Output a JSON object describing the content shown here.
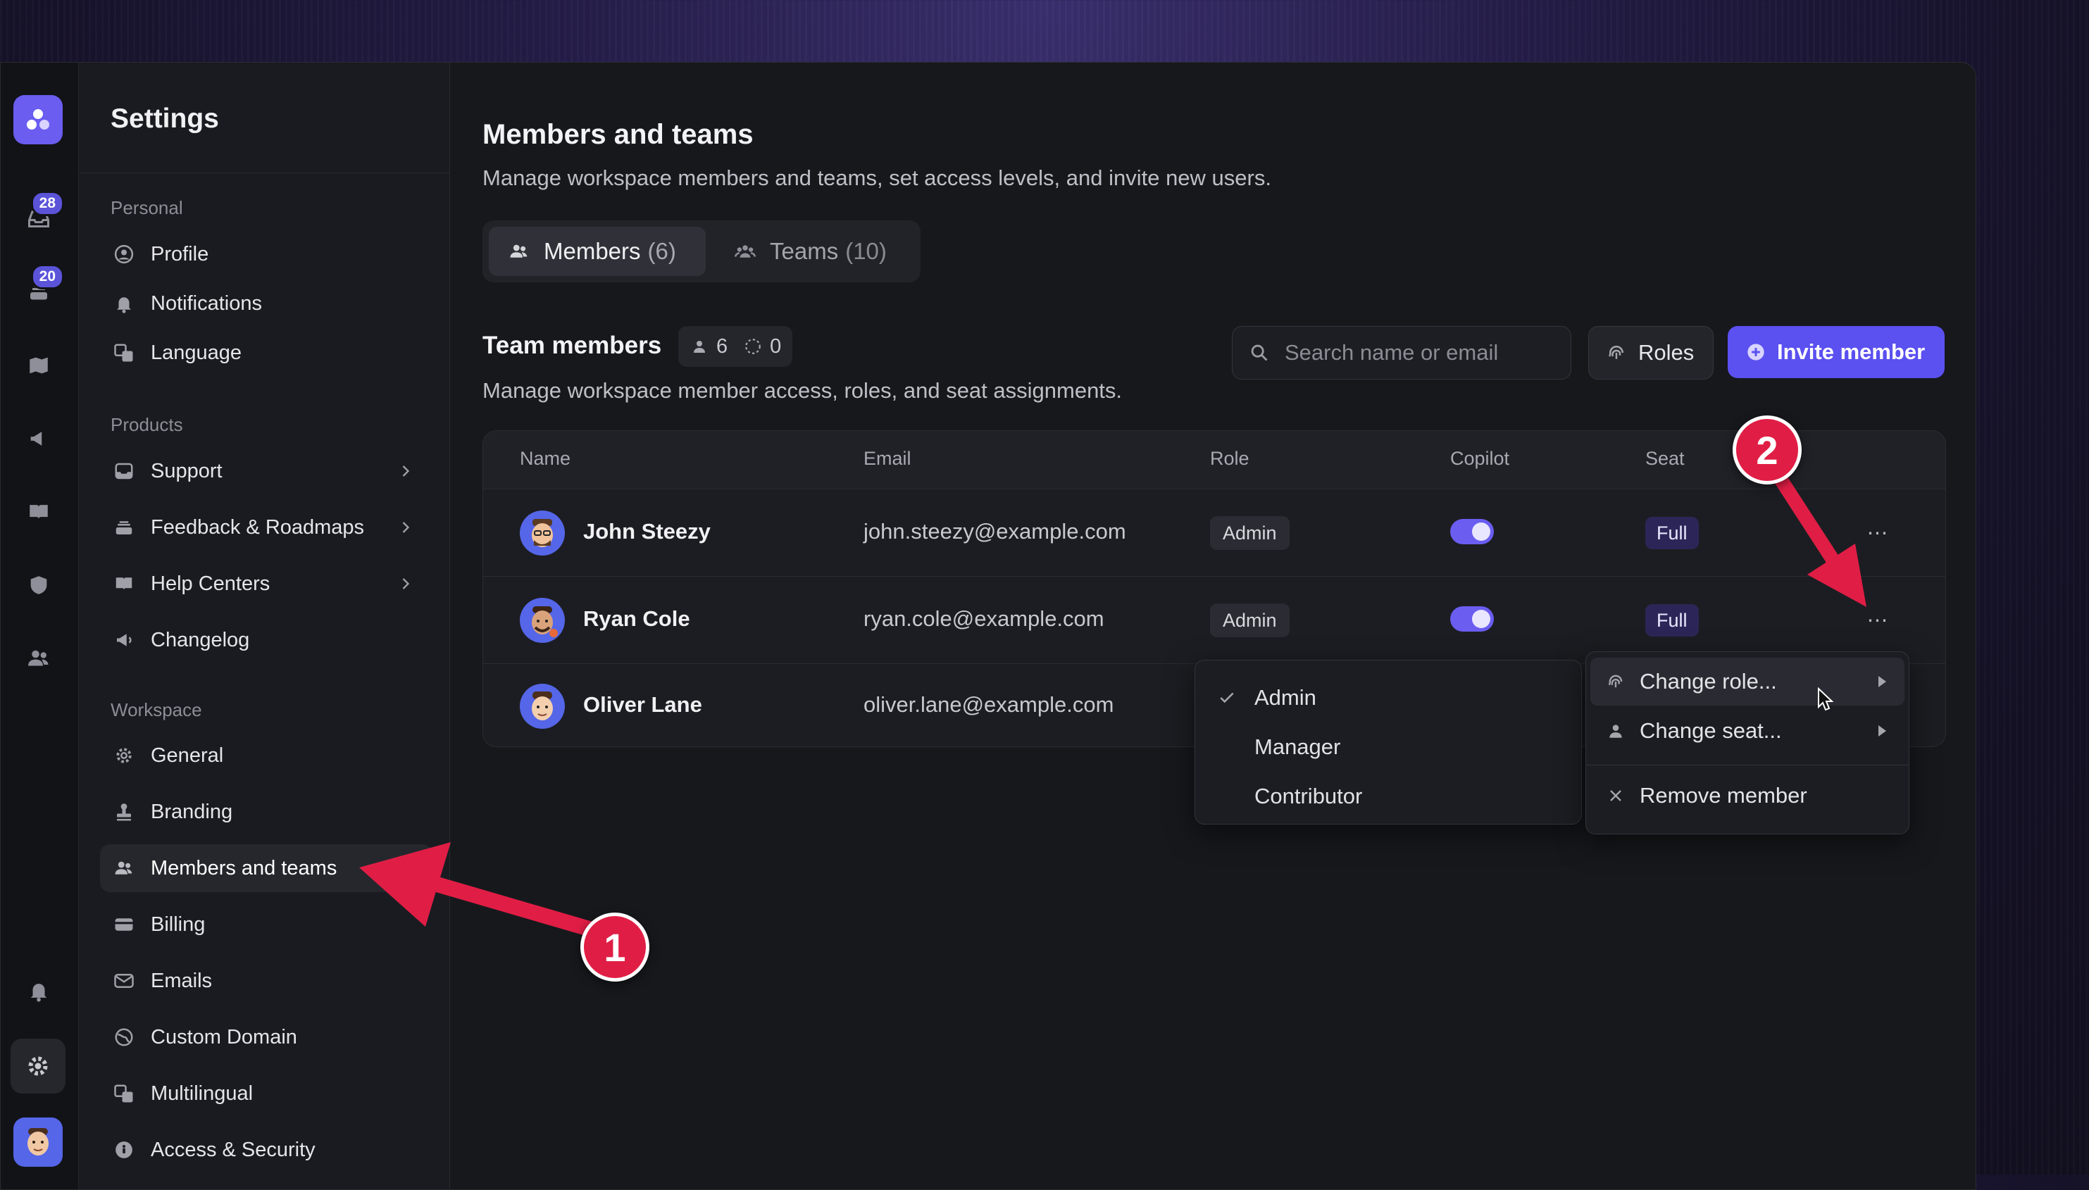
{
  "rail": {
    "badges": [
      "28",
      "20"
    ]
  },
  "sidebar": {
    "title": "Settings",
    "sections": [
      {
        "label": "Personal",
        "items": [
          {
            "label": "Profile",
            "icon": "user-circle-icon"
          },
          {
            "label": "Notifications",
            "icon": "bell-icon"
          },
          {
            "label": "Language",
            "icon": "translate-icon"
          }
        ]
      },
      {
        "label": "Products",
        "items": [
          {
            "label": "Support",
            "icon": "inbox-icon"
          },
          {
            "label": "Feedback & Roadmaps",
            "icon": "stack-icon"
          },
          {
            "label": "Help Centers",
            "icon": "book-icon"
          },
          {
            "label": "Changelog",
            "icon": "megaphone-icon"
          }
        ]
      },
      {
        "label": "Workspace",
        "items": [
          {
            "label": "General",
            "icon": "gear-icon"
          },
          {
            "label": "Branding",
            "icon": "stamp-icon"
          },
          {
            "label": "Members and teams",
            "icon": "users-icon"
          },
          {
            "label": "Billing",
            "icon": "credit-card-icon"
          },
          {
            "label": "Emails",
            "icon": "mail-icon"
          },
          {
            "label": "Custom Domain",
            "icon": "globe-icon"
          },
          {
            "label": "Multilingual",
            "icon": "translate-icon"
          },
          {
            "label": "Access & Security",
            "icon": "shield-icon"
          }
        ]
      }
    ]
  },
  "page": {
    "title": "Members and teams",
    "subtitle": "Manage workspace members and teams, set access levels, and invite new users."
  },
  "tabs": [
    {
      "label": "Members",
      "count": "(6)"
    },
    {
      "label": "Teams",
      "count": "(10)"
    }
  ],
  "members_section": {
    "title": "Team members",
    "active_count": "6",
    "pending_count": "0",
    "subtitle": "Manage workspace member access, roles, and seat assignments.",
    "search_placeholder": "Search name or email",
    "roles_label": "Roles",
    "invite_label": "Invite member"
  },
  "table": {
    "headers": [
      "Name",
      "Email",
      "Role",
      "Copilot",
      "Seat"
    ],
    "rows": [
      {
        "name": "John Steezy",
        "email": "john.steezy@example.com",
        "role": "Admin",
        "copilot": true,
        "seat": "Full"
      },
      {
        "name": "Ryan Cole",
        "email": "ryan.cole@example.com",
        "role": "Admin",
        "copilot": true,
        "seat": "Full"
      },
      {
        "name": "Oliver Lane",
        "email": "oliver.lane@example.com",
        "role": "",
        "copilot": false,
        "seat": ""
      }
    ]
  },
  "role_menu": {
    "options": [
      "Admin",
      "Manager",
      "Contributor"
    ],
    "selected": "Admin"
  },
  "actions_menu": {
    "items": [
      "Change role...",
      "Change seat...",
      "Remove member"
    ]
  },
  "annotations": [
    "1",
    "2"
  ],
  "colors": {
    "accent": "#5b50f0",
    "annotation": "#e01e45"
  }
}
